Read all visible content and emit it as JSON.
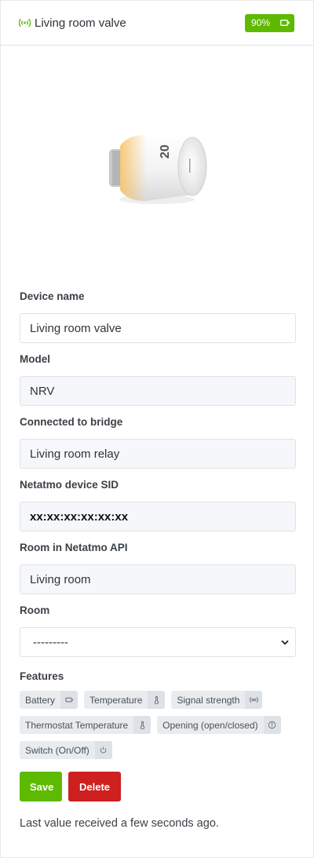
{
  "header": {
    "title": "Living room valve",
    "battery_label": "90%"
  },
  "image": {
    "alt": "Netatmo smart radiator valve"
  },
  "form": {
    "device_name": {
      "label": "Device name",
      "value": "Living room valve"
    },
    "model": {
      "label": "Model",
      "value": "NRV"
    },
    "bridge": {
      "label": "Connected to bridge",
      "value": "Living room relay"
    },
    "sid": {
      "label": "Netatmo device SID",
      "value": "xx:xx:xx:xx:xx:xx"
    },
    "api_room": {
      "label": "Room in Netatmo API",
      "value": "Living room"
    },
    "room": {
      "label": "Room",
      "selected": "---------"
    }
  },
  "features": {
    "label": "Features",
    "items": [
      {
        "label": "Battery",
        "icon": "battery-icon"
      },
      {
        "label": "Temperature",
        "icon": "thermometer-icon"
      },
      {
        "label": "Signal strength",
        "icon": "signal-icon"
      },
      {
        "label": "Thermostat Temperature",
        "icon": "thermometer-icon"
      },
      {
        "label": "Opening (open/closed)",
        "icon": "info-icon"
      },
      {
        "label": "Switch (On/Off)",
        "icon": "power-icon"
      }
    ]
  },
  "actions": {
    "save": "Save",
    "delete": "Delete"
  },
  "status": "Last value received a few seconds ago.",
  "colors": {
    "success": "#5eba00",
    "danger": "#cd201f"
  }
}
